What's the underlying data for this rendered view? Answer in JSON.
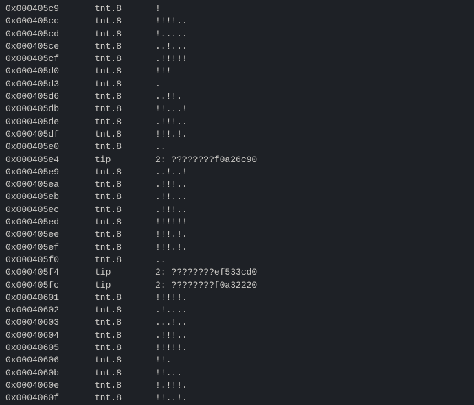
{
  "rows": [
    {
      "addr": "0x000405c9",
      "type": "tnt.8",
      "detail": "!"
    },
    {
      "addr": "0x000405cc",
      "type": "tnt.8",
      "detail": "!!!!.."
    },
    {
      "addr": "0x000405cd",
      "type": "tnt.8",
      "detail": "!....."
    },
    {
      "addr": "0x000405ce",
      "type": "tnt.8",
      "detail": "..!..."
    },
    {
      "addr": "0x000405cf",
      "type": "tnt.8",
      "detail": ".!!!!!"
    },
    {
      "addr": "0x000405d0",
      "type": "tnt.8",
      "detail": "!!!"
    },
    {
      "addr": "0x000405d3",
      "type": "tnt.8",
      "detail": "."
    },
    {
      "addr": "0x000405d6",
      "type": "tnt.8",
      "detail": "..!!."
    },
    {
      "addr": "0x000405db",
      "type": "tnt.8",
      "detail": "!!...!"
    },
    {
      "addr": "0x000405de",
      "type": "tnt.8",
      "detail": ".!!!.."
    },
    {
      "addr": "0x000405df",
      "type": "tnt.8",
      "detail": "!!!.!."
    },
    {
      "addr": "0x000405e0",
      "type": "tnt.8",
      "detail": ".."
    },
    {
      "addr": "0x000405e4",
      "type": "tip",
      "detail": "2: ????????f0a26c90"
    },
    {
      "addr": "0x000405e9",
      "type": "tnt.8",
      "detail": "..!..!"
    },
    {
      "addr": "0x000405ea",
      "type": "tnt.8",
      "detail": ".!!!.."
    },
    {
      "addr": "0x000405eb",
      "type": "tnt.8",
      "detail": ".!!..."
    },
    {
      "addr": "0x000405ec",
      "type": "tnt.8",
      "detail": ".!!!.."
    },
    {
      "addr": "0x000405ed",
      "type": "tnt.8",
      "detail": "!!!!!!"
    },
    {
      "addr": "0x000405ee",
      "type": "tnt.8",
      "detail": "!!!.!."
    },
    {
      "addr": "0x000405ef",
      "type": "tnt.8",
      "detail": "!!!.!."
    },
    {
      "addr": "0x000405f0",
      "type": "tnt.8",
      "detail": ".."
    },
    {
      "addr": "0x000405f4",
      "type": "tip",
      "detail": "2: ????????ef533cd0"
    },
    {
      "addr": "0x000405fc",
      "type": "tip",
      "detail": "2: ????????f0a32220"
    },
    {
      "addr": "0x00040601",
      "type": "tnt.8",
      "detail": "!!!!!."
    },
    {
      "addr": "0x00040602",
      "type": "tnt.8",
      "detail": ".!...."
    },
    {
      "addr": "0x00040603",
      "type": "tnt.8",
      "detail": "...!.."
    },
    {
      "addr": "0x00040604",
      "type": "tnt.8",
      "detail": ".!!!.."
    },
    {
      "addr": "0x00040605",
      "type": "tnt.8",
      "detail": "!!!!!."
    },
    {
      "addr": "0x00040606",
      "type": "tnt.8",
      "detail": "!!."
    },
    {
      "addr": "0x0004060b",
      "type": "tnt.8",
      "detail": "!!..."
    },
    {
      "addr": "0x0004060e",
      "type": "tnt.8",
      "detail": "!.!!!."
    },
    {
      "addr": "0x0004060f",
      "type": "tnt.8",
      "detail": "!!..!."
    }
  ]
}
